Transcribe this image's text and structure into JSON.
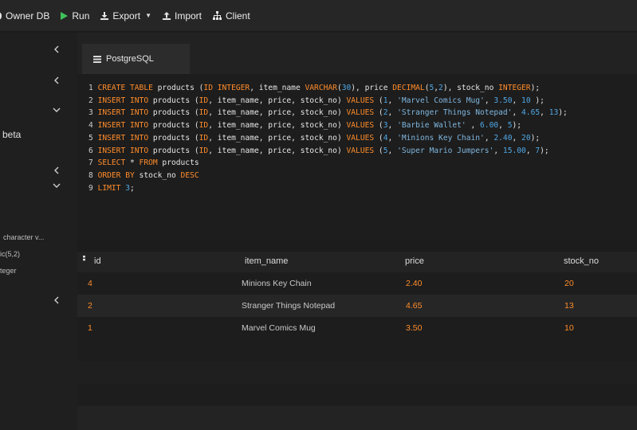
{
  "toolbar": {
    "items": [
      {
        "label": "Owner DB",
        "icon": "database-icon"
      },
      {
        "label": "Run",
        "icon": "play-icon"
      },
      {
        "label": "Export",
        "icon": "download-icon"
      },
      {
        "label": "Import",
        "icon": "upload-icon"
      },
      {
        "label": "Client",
        "icon": "client-tree-icon"
      }
    ]
  },
  "sidebar": {
    "beta_label": "beta",
    "columns": [
      "character v...",
      "ic(5,2)",
      "teger"
    ]
  },
  "editor": {
    "tab_label": "PostgreSQL",
    "lines": [
      [
        [
          "ln",
          "1 "
        ],
        [
          "kw",
          "CREATE TABLE"
        ],
        [
          "tx",
          " products ("
        ],
        [
          "kw",
          "ID INTEGER"
        ],
        [
          "tx",
          ", item_name "
        ],
        [
          "kw",
          "VARCHAR"
        ],
        [
          "tx",
          "("
        ],
        [
          "num",
          "30"
        ],
        [
          "tx",
          "), price "
        ],
        [
          "kw",
          "DECIMAL"
        ],
        [
          "tx",
          "("
        ],
        [
          "num",
          "5"
        ],
        [
          "tx",
          ","
        ],
        [
          "num",
          "2"
        ],
        [
          "tx",
          "), stock_no "
        ],
        [
          "kw",
          "INTEGER"
        ],
        [
          "tx",
          ");"
        ]
      ],
      [
        [
          "ln",
          "2 "
        ],
        [
          "kw",
          "INSERT INTO"
        ],
        [
          "tx",
          " products ("
        ],
        [
          "kw",
          "ID"
        ],
        [
          "tx",
          ", item_name, price, stock_no) "
        ],
        [
          "kw",
          "VALUES"
        ],
        [
          "tx",
          " ("
        ],
        [
          "num",
          "1"
        ],
        [
          "tx",
          ", "
        ],
        [
          "str",
          "'Marvel Comics Mug'"
        ],
        [
          "tx",
          ", "
        ],
        [
          "num",
          "3.50"
        ],
        [
          "tx",
          ", "
        ],
        [
          "num",
          "10"
        ],
        [
          "tx",
          " );"
        ]
      ],
      [
        [
          "ln",
          "3 "
        ],
        [
          "kw",
          "INSERT INTO"
        ],
        [
          "tx",
          " products ("
        ],
        [
          "kw",
          "ID"
        ],
        [
          "tx",
          ", item_name, price, stock_no) "
        ],
        [
          "kw",
          "VALUES"
        ],
        [
          "tx",
          " ("
        ],
        [
          "num",
          "2"
        ],
        [
          "tx",
          ", "
        ],
        [
          "str",
          "'Stranger Things Notepad'"
        ],
        [
          "tx",
          ", "
        ],
        [
          "num",
          "4.65"
        ],
        [
          "tx",
          ", "
        ],
        [
          "num",
          "13"
        ],
        [
          "tx",
          ");"
        ]
      ],
      [
        [
          "ln",
          "4 "
        ],
        [
          "kw",
          "INSERT INTO"
        ],
        [
          "tx",
          " products ("
        ],
        [
          "kw",
          "ID"
        ],
        [
          "tx",
          ", item_name, price, stock_no) "
        ],
        [
          "kw",
          "VALUES"
        ],
        [
          "tx",
          " ("
        ],
        [
          "num",
          "3"
        ],
        [
          "tx",
          ", "
        ],
        [
          "str",
          "'Barbie Wallet'"
        ],
        [
          "tx",
          " , "
        ],
        [
          "num",
          "6.00"
        ],
        [
          "tx",
          ", "
        ],
        [
          "num",
          "5"
        ],
        [
          "tx",
          ");"
        ]
      ],
      [
        [
          "ln",
          "5 "
        ],
        [
          "kw",
          "INSERT INTO"
        ],
        [
          "tx",
          " products ("
        ],
        [
          "kw",
          "ID"
        ],
        [
          "tx",
          ", item_name, price, stock_no) "
        ],
        [
          "kw",
          "VALUES"
        ],
        [
          "tx",
          " ("
        ],
        [
          "num",
          "4"
        ],
        [
          "tx",
          ", "
        ],
        [
          "str",
          "'Minions Key Chain'"
        ],
        [
          "tx",
          ", "
        ],
        [
          "num",
          "2.40"
        ],
        [
          "tx",
          ", "
        ],
        [
          "num",
          "20"
        ],
        [
          "tx",
          ");"
        ]
      ],
      [
        [
          "ln",
          "6 "
        ],
        [
          "kw",
          "INSERT INTO"
        ],
        [
          "tx",
          " products ("
        ],
        [
          "kw",
          "ID"
        ],
        [
          "tx",
          ", item_name, price, stock_no) "
        ],
        [
          "kw",
          "VALUES"
        ],
        [
          "tx",
          " ("
        ],
        [
          "num",
          "5"
        ],
        [
          "tx",
          ", "
        ],
        [
          "str",
          "'Super Mario Jumpers'"
        ],
        [
          "tx",
          ", "
        ],
        [
          "num",
          "15.00"
        ],
        [
          "tx",
          ", "
        ],
        [
          "num",
          "7"
        ],
        [
          "tx",
          ");"
        ]
      ],
      [
        [
          "ln",
          "7 "
        ],
        [
          "kw",
          "SELECT"
        ],
        [
          "tx",
          " * "
        ],
        [
          "kw",
          "FROM"
        ],
        [
          "tx",
          " products"
        ]
      ],
      [
        [
          "ln",
          "8 "
        ],
        [
          "kw",
          "ORDER BY"
        ],
        [
          "tx",
          " stock_no "
        ],
        [
          "kw",
          "DESC"
        ]
      ],
      [
        [
          "ln",
          "9 "
        ],
        [
          "kw",
          "LIMIT"
        ],
        [
          "tx",
          " "
        ],
        [
          "num",
          "3"
        ],
        [
          "tx",
          ";"
        ]
      ]
    ]
  },
  "results": {
    "columns": [
      "id",
      "item_name",
      "price",
      "stock_no"
    ],
    "rows": [
      [
        "4",
        "Minions Key Chain",
        "2.40",
        "20"
      ],
      [
        "2",
        "Stranger Things Notepad",
        "4.65",
        "13"
      ],
      [
        "1",
        "Marvel Comics Mug",
        "3.50",
        "10"
      ]
    ]
  },
  "colors": {
    "keyword": "#ff8c2a",
    "string": "#7fb6df",
    "number": "#4fa8e6",
    "run_icon": "#3fc15a"
  }
}
